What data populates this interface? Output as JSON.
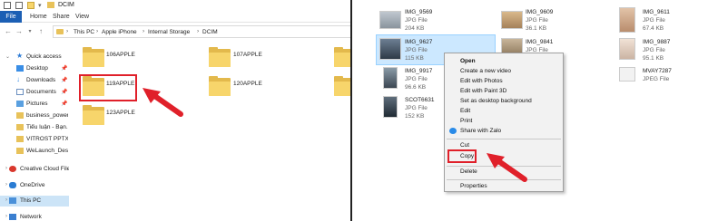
{
  "left_window": {
    "title": "DCIM",
    "ribbon": {
      "file_tab": "File",
      "tabs": [
        "Home",
        "Share",
        "View"
      ]
    },
    "breadcrumbs": [
      "This PC",
      "Apple iPhone",
      "Internal Storage",
      "DCIM"
    ],
    "sidebar": [
      {
        "label": "Quick access",
        "icon": "star-icon",
        "pinned": false
      },
      {
        "label": "Desktop",
        "icon": "desktop-icon",
        "pinned": true
      },
      {
        "label": "Downloads",
        "icon": "download-icon",
        "pinned": true
      },
      {
        "label": "Documents",
        "icon": "document-icon",
        "pinned": true
      },
      {
        "label": "Pictures",
        "icon": "pictures-icon",
        "pinned": true
      },
      {
        "label": "business_power",
        "icon": "folder-icon",
        "pinned": false
      },
      {
        "label": "Tiểu luận - Bạn...",
        "icon": "folder-icon",
        "pinned": false
      },
      {
        "label": "VITROST PPTX",
        "icon": "folder-icon",
        "pinned": false
      },
      {
        "label": "WeLaunch_Desig",
        "icon": "folder-icon",
        "pinned": false
      },
      {
        "label": "Creative Cloud Files",
        "icon": "creative-cloud-icon",
        "pinned": false
      },
      {
        "label": "OneDrive",
        "icon": "onedrive-icon",
        "pinned": false
      },
      {
        "label": "This PC",
        "icon": "computer-icon",
        "pinned": false,
        "selected": true
      },
      {
        "label": "Network",
        "icon": "network-icon",
        "pinned": false
      }
    ],
    "folders": [
      "106APPLE",
      "107APPLE",
      "119APPLE",
      "120APPLE",
      "123APPLE"
    ],
    "highlighted_folder": "119APPLE"
  },
  "right_window": {
    "files": [
      {
        "name": "IMG_9569",
        "type": "JPG File",
        "size": "204 KB"
      },
      {
        "name": "IMG_9609",
        "type": "JPG File",
        "size": "36.1 KB"
      },
      {
        "name": "IMG_9611",
        "type": "JPG File",
        "size": "67.4 KB"
      },
      {
        "name": "IMG_9627",
        "type": "JPG File",
        "size": "115 KB",
        "selected": true
      },
      {
        "name": "IMG_9841",
        "type": "JPG File",
        "size": ""
      },
      {
        "name": "IMG_9887",
        "type": "JPG File",
        "size": "95.1 KB"
      },
      {
        "name": "IMG_9917",
        "type": "JPG File",
        "size": "96.6 KB"
      },
      {
        "name": "MVAY7287",
        "type": "JPEG File",
        "size": ""
      },
      {
        "name": "SCOT6631",
        "type": "JPG File",
        "size": "152 KB"
      }
    ],
    "context_menu": {
      "items": [
        "Open",
        "Create a new video",
        "Edit with Photos",
        "Edit with Paint 3D",
        "Set as desktop background",
        "Edit",
        "Print",
        "Share with Zalo",
        "Cut",
        "Copy",
        "Delete",
        "Properties"
      ],
      "highlighted": "Copy"
    }
  },
  "colors": {
    "accent": "#1c5fb4",
    "highlight_red": "#e0202a",
    "folder": "#f7d56b",
    "selection": "#cce8ff"
  }
}
